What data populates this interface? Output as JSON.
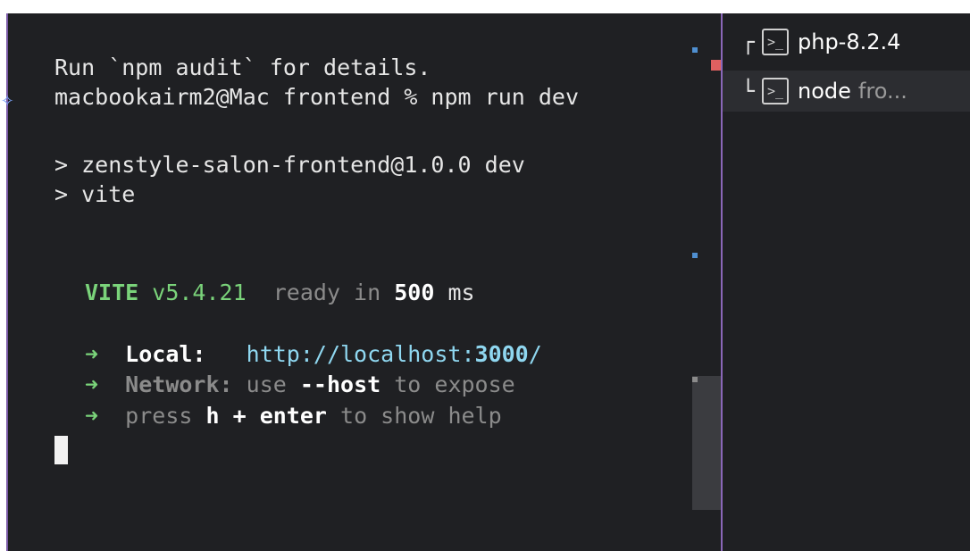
{
  "terminal": {
    "lines": {
      "audit": "Run `npm audit` for details.",
      "prompt_user": "macbookairm2@Mac frontend % npm run dev",
      "script_name": "> zenstyle-salon-frontend@1.0.0 dev",
      "script_cmd": "> vite",
      "vite_label": "VITE",
      "vite_version": "v5.4.21",
      "ready_text": "ready in",
      "ready_ms_value": "500",
      "ready_ms_unit": "ms",
      "local_label": "Local:",
      "local_url_prefix": "http://localhost:",
      "local_port": "3000",
      "local_url_suffix": "/",
      "network_label": "Network:",
      "network_use": "use",
      "network_flag": "--host",
      "network_tail": "to expose",
      "help_press": "press",
      "help_keys": "h + enter",
      "help_tail": "to show help",
      "arrow": "➜"
    }
  },
  "sidebar": {
    "items": [
      {
        "tree": "┌",
        "name": "php-8.2.4",
        "dir": "",
        "icon": "terminal-icon"
      },
      {
        "tree": "└",
        "name": "node",
        "dir": "fro...",
        "icon": "terminal-icon"
      }
    ]
  },
  "colors": {
    "background": "#1f2023",
    "accent_divider": "#8a67b8",
    "vite_green": "#7ad37a",
    "url_cyan": "#8fd7f0"
  }
}
